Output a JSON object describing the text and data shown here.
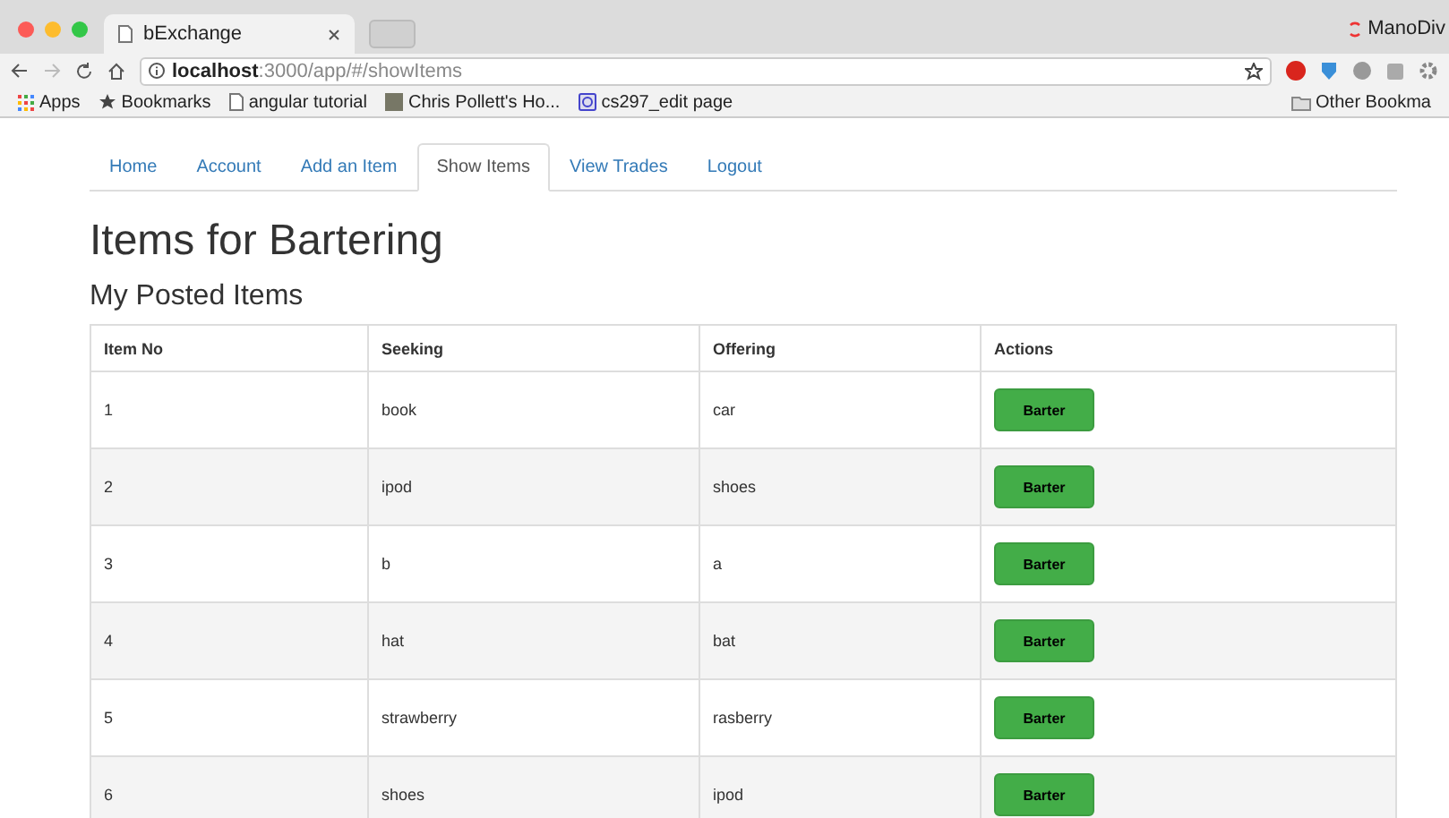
{
  "browser": {
    "tab_title": "bExchange",
    "url_host": "localhost",
    "url_path": ":3000/app/#/showItems",
    "profile": "ManoDiv",
    "bookmarks": [
      {
        "kind": "apps",
        "label": "Apps"
      },
      {
        "kind": "star",
        "label": "Bookmarks"
      },
      {
        "kind": "page",
        "label": "angular tutorial"
      },
      {
        "kind": "photo",
        "label": "Chris Pollett's Ho..."
      },
      {
        "kind": "site",
        "label": "cs297_edit page"
      }
    ],
    "other_bookmarks": "Other Bookma"
  },
  "nav": [
    {
      "label": "Home",
      "selected": false
    },
    {
      "label": "Account",
      "selected": false
    },
    {
      "label": "Add an Item",
      "selected": false
    },
    {
      "label": "Show Items",
      "selected": true
    },
    {
      "label": "View Trades",
      "selected": false
    },
    {
      "label": "Logout",
      "selected": false
    }
  ],
  "title": "Items for Bartering",
  "subtitle": "My Posted Items",
  "table": {
    "columns": [
      "Item No",
      "Seeking",
      "Offering",
      "Actions"
    ],
    "rows": [
      {
        "item_no": "1",
        "seeking": "book",
        "offering": "car",
        "action": "Barter"
      },
      {
        "item_no": "2",
        "seeking": "ipod",
        "offering": "shoes",
        "action": "Barter"
      },
      {
        "item_no": "3",
        "seeking": "b",
        "offering": "a",
        "action": "Barter"
      },
      {
        "item_no": "4",
        "seeking": "hat",
        "offering": "bat",
        "action": "Barter"
      },
      {
        "item_no": "5",
        "seeking": "strawberry",
        "offering": "rasberry",
        "action": "Barter"
      },
      {
        "item_no": "6",
        "seeking": "shoes",
        "offering": "ipod",
        "action": "Barter"
      }
    ]
  }
}
